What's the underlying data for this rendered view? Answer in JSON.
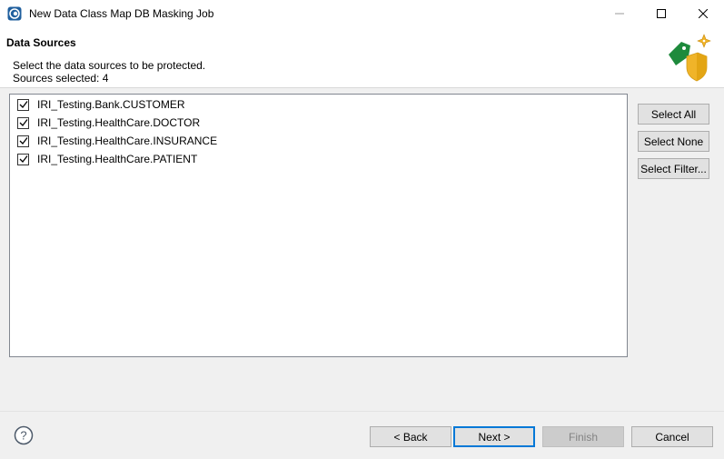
{
  "window": {
    "title": "New Data Class Map DB Masking Job"
  },
  "header": {
    "title": "Data Sources",
    "description": "Select the data sources to be protected.",
    "sources_selected": "Sources selected: 4"
  },
  "sources": [
    {
      "label": "IRI_Testing.Bank.CUSTOMER",
      "checked": true
    },
    {
      "label": "IRI_Testing.HealthCare.DOCTOR",
      "checked": true
    },
    {
      "label": "IRI_Testing.HealthCare.INSURANCE",
      "checked": true
    },
    {
      "label": "IRI_Testing.HealthCare.PATIENT",
      "checked": true
    }
  ],
  "side_buttons": {
    "select_all": "Select All",
    "select_none": "Select None",
    "select_filter": "Select Filter..."
  },
  "footer": {
    "back": "< Back",
    "next": "Next >",
    "finish": "Finish",
    "cancel": "Cancel"
  },
  "colors": {
    "accent": "#0078d7",
    "tag_green": "#1e8a3c",
    "shield_gold": "#f0b429"
  },
  "icons": {
    "app": "app-logo-icon",
    "minimize": "minimize-icon",
    "maximize": "maximize-icon",
    "close": "close-icon",
    "header": "tag-shield-icon",
    "help": "help-icon",
    "check": "checkmark-icon"
  }
}
